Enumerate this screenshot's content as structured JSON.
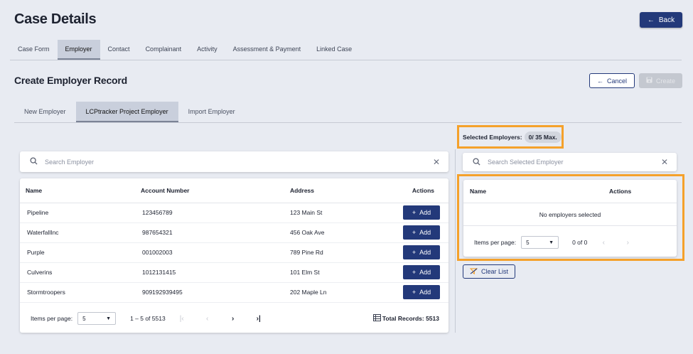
{
  "header": {
    "title": "Case Details",
    "back_label": "Back"
  },
  "tabs": [
    {
      "label": "Case Form"
    },
    {
      "label": "Employer",
      "active": true
    },
    {
      "label": "Contact"
    },
    {
      "label": "Complainant"
    },
    {
      "label": "Activity"
    },
    {
      "label": "Assessment & Payment"
    },
    {
      "label": "Linked Case"
    }
  ],
  "section": {
    "title": "Create Employer Record",
    "cancel_label": "Cancel",
    "create_label": "Create"
  },
  "subtabs": [
    {
      "label": "New Employer"
    },
    {
      "label": "LCPtracker Project Employer",
      "active": true
    },
    {
      "label": "Import Employer"
    }
  ],
  "employer_search": {
    "placeholder": "Search Employer"
  },
  "employer_table": {
    "columns": {
      "name": "Name",
      "account": "Account Number",
      "address": "Address",
      "actions": "Actions"
    },
    "add_label": "Add",
    "rows": [
      {
        "name": "Pipeline",
        "account": "123456789",
        "address": "123 Main St"
      },
      {
        "name": "WaterfallInc",
        "account": "987654321",
        "address": "456 Oak Ave"
      },
      {
        "name": "Purple",
        "account": "001002003",
        "address": "789 Pine Rd"
      },
      {
        "name": "Culverins",
        "account": "1012131415",
        "address": "101 Elm St"
      },
      {
        "name": "Stormtroopers",
        "account": "909192939495",
        "address": "202 Maple Ln"
      }
    ],
    "pager": {
      "items_label": "Items per page:",
      "page_size": "5",
      "range": "1 – 5 of 5513",
      "total": "Total Records: 5513"
    }
  },
  "selected": {
    "label": "Selected Employers:",
    "count": "0/ 35 Max.",
    "search_placeholder": "Search Selected Employer",
    "columns": {
      "name": "Name",
      "actions": "Actions"
    },
    "empty_text": "No employers selected",
    "pager": {
      "items_label": "Items per page:",
      "page_size": "5",
      "range": "0 of 0"
    },
    "clear_label": "Clear List"
  },
  "colors": {
    "primary": "#23397a",
    "highlight": "#f5a12b",
    "background": "#e8ebf2"
  }
}
